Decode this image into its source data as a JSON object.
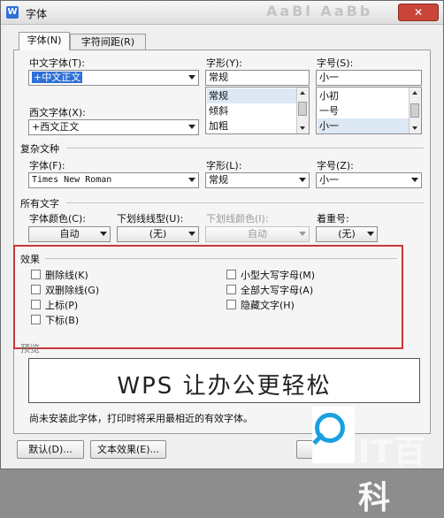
{
  "window": {
    "title": "字体",
    "app_icon": "W",
    "close_label": "✕"
  },
  "background_blur_text": "AaBl AaBb",
  "tabs": [
    {
      "label": "字体(N)"
    },
    {
      "label": "字符间距(R)"
    }
  ],
  "font": {
    "cn_font_label": "中文字体(T):",
    "cn_font_value": "+中文正文",
    "west_font_label": "西文字体(X):",
    "west_font_value": "+西文正文",
    "style_label": "字形(Y):",
    "style_value": "常规",
    "style_options": [
      "常规",
      "倾斜",
      "加粗"
    ],
    "size_label": "字号(S):",
    "size_value": "小一",
    "size_options": [
      "小初",
      "一号",
      "小一"
    ]
  },
  "complex": {
    "section_label": "复杂文种",
    "font_label": "字体(F):",
    "font_value": "Times New Roman",
    "style_label": "字形(L):",
    "style_value": "常规",
    "size_label": "字号(Z):",
    "size_value": "小一"
  },
  "all_text": {
    "section_label": "所有文字",
    "color_label": "字体颜色(C):",
    "color_value": "自动",
    "underline_type_label": "下划线线型(U):",
    "underline_type_value": "(无)",
    "underline_color_label": "下划线颜色(I):",
    "underline_color_value": "自动",
    "emphasis_label": "着重号:",
    "emphasis_value": "(无)"
  },
  "effects": {
    "section_label": "效果",
    "left": [
      "删除线(K)",
      "双删除线(G)",
      "上标(P)",
      "下标(B)"
    ],
    "right": [
      "小型大写字母(M)",
      "全部大写字母(A)",
      "隐藏文字(H)"
    ]
  },
  "preview": {
    "section_label": "预览",
    "text": "WPS 让办公更轻松",
    "note": "尚未安装此字体，打印时将采用最相近的有效字体。"
  },
  "buttons": {
    "default": "默认(D)...",
    "text_effects": "文本效果(E)..."
  },
  "watermark": {
    "brand_small": "PConline",
    "brand_large": "IT百科",
    "accent_color": "#1aa0e0"
  },
  "colors": {
    "highlight": "#2f6fd6",
    "effects_border": "#c8373a"
  }
}
